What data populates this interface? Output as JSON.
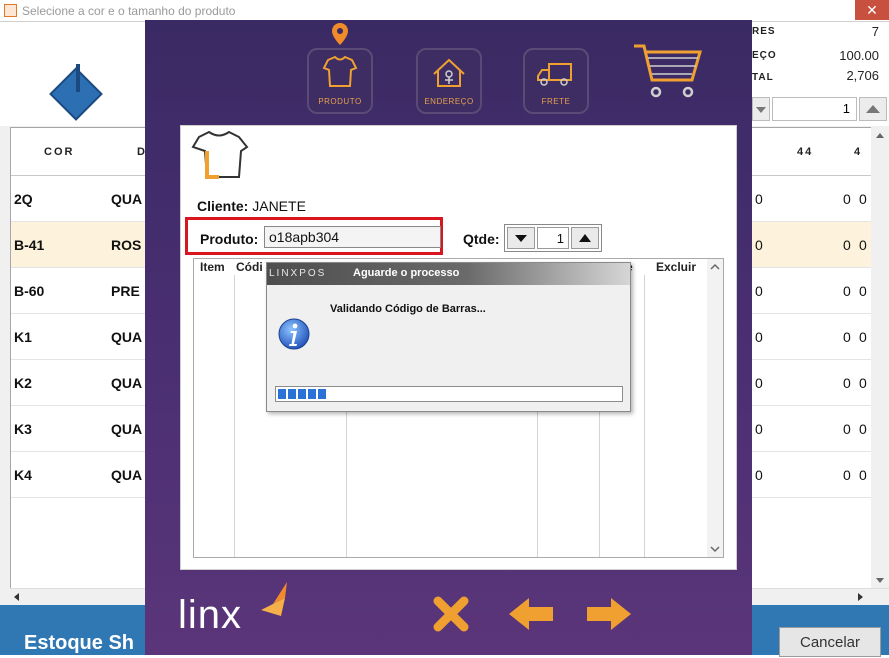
{
  "window": {
    "title": "Selecione a cor e o tamanho do produto",
    "close": "✕"
  },
  "summary": {
    "rows": [
      {
        "label": "RES",
        "value": "7"
      },
      {
        "label": "EÇO",
        "value": "100.00"
      },
      {
        "label": "TAL",
        "value": "2,706"
      }
    ],
    "quantity": "1"
  },
  "grid": {
    "headers": {
      "cor": "COR",
      "desc": "D",
      "size44": "44",
      "size46": "4"
    },
    "rows": [
      {
        "cor": "2Q",
        "desc": "QUA",
        "n1": "0",
        "n2": "0",
        "n3": "0",
        "selected": false
      },
      {
        "cor": "B-41",
        "desc": "ROS",
        "n1": "0",
        "n2": "0",
        "n3": "0",
        "selected": true
      },
      {
        "cor": "B-60",
        "desc": "PRE",
        "n1": "0",
        "n2": "0",
        "n3": "0",
        "selected": false
      },
      {
        "cor": "K1",
        "desc": "QUA",
        "n1": "0",
        "n2": "0",
        "n3": "0",
        "selected": false
      },
      {
        "cor": "K2",
        "desc": "QUA",
        "n1": "0",
        "n2": "0",
        "n3": "0",
        "selected": false
      },
      {
        "cor": "K3",
        "desc": "QUA",
        "n1": "0",
        "n2": "0",
        "n3": "0",
        "selected": false
      },
      {
        "cor": "K4",
        "desc": "QUA",
        "n1": "0",
        "n2": "0",
        "n3": "0",
        "selected": false
      }
    ]
  },
  "footer": {
    "estoque": "Estoque Sh",
    "cancel": "Cancelar"
  },
  "pos": {
    "nav": {
      "produto": "PRODUTO",
      "endereco": "ENDEREÇO",
      "frete": "FRETE"
    },
    "client_label": "Cliente:",
    "client_name": "JANETE",
    "product_label": "Produto:",
    "product_code": "o18apb304",
    "qtde_label": "Qtde:",
    "qtde_value": "1",
    "items_headers": {
      "item": "Item",
      "codigo": "Códi",
      "col3": "e",
      "excluir": "Excluir"
    },
    "logo": "linx"
  },
  "dialog": {
    "brand": "LINXPOS",
    "title": "Aguarde o processo",
    "message": "Validando Código de Barras...",
    "progress": 0.14
  },
  "colors": {
    "accent_orange": "#f0a030",
    "purple_bg": "#44306b",
    "highlight_red": "#d9151f",
    "footer_blue": "#2f78b4"
  }
}
